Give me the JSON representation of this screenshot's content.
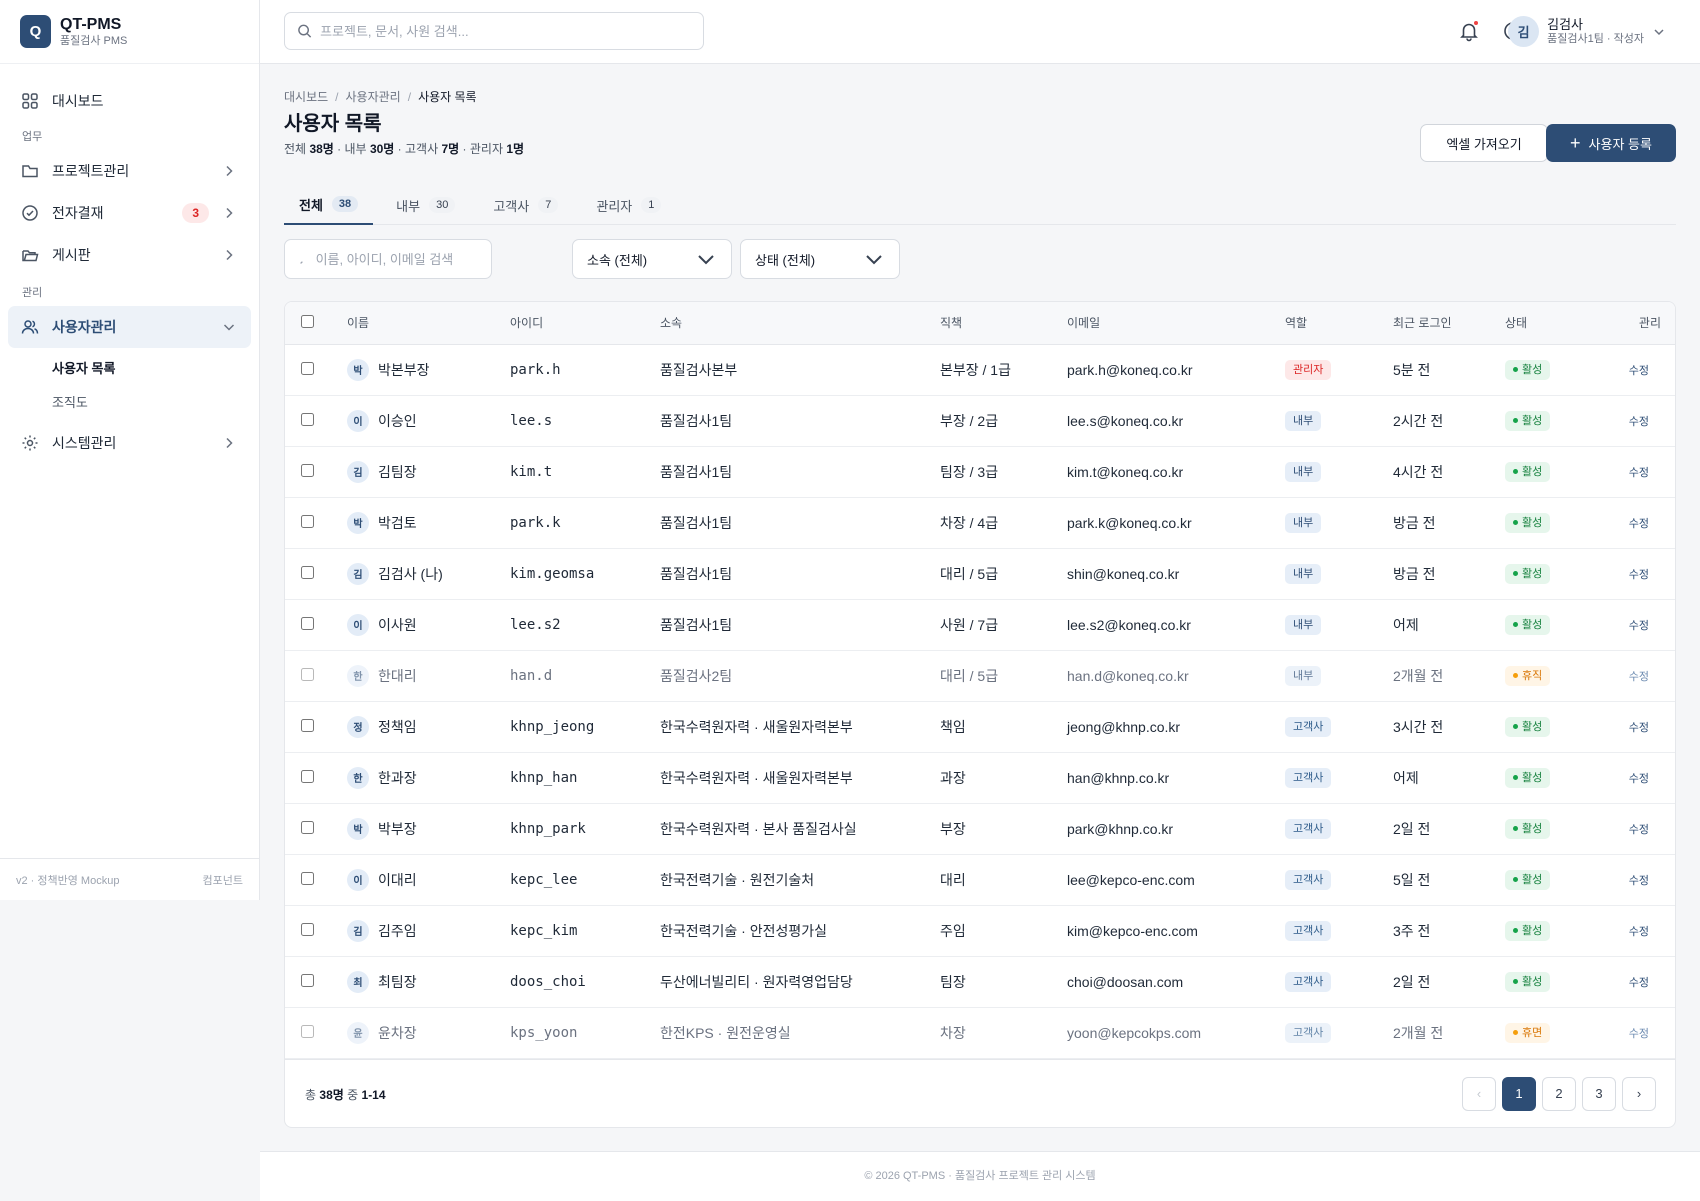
{
  "brand": {
    "logo": "Q",
    "title": "QT-PMS",
    "subtitle": "품질검사 PMS"
  },
  "sidebar": {
    "dashboard": "대시보드",
    "section_work": "업무",
    "projects": "프로젝트관리",
    "approval": "전자결재",
    "approval_badge": "3",
    "board": "게시판",
    "section_admin": "관리",
    "users": "사용자관리",
    "sub_user_list": "사용자 목록",
    "sub_org": "조직도",
    "system": "시스템관리",
    "footer_left": "v2 · 정책반영 Mockup",
    "footer_right": "컴포넌트"
  },
  "topbar": {
    "search_placeholder": "프로젝트, 문서, 사원 검색...",
    "user_initial": "김",
    "user_name": "김검사",
    "user_role": "품질검사1팀 · 작성자"
  },
  "breadcrumb": {
    "a": "대시보드",
    "b": "사용자관리",
    "current": "사용자 목록"
  },
  "page": {
    "title": "사용자 목록",
    "sub_total_label": "전체",
    "sub_total": "38명",
    "sub_internal_label": "· 내부",
    "sub_internal": "30명",
    "sub_client_label": "· 고객사",
    "sub_client": "7명",
    "sub_admin_label": "· 관리자",
    "sub_admin": "1명",
    "btn_excel": "엑셀 가져오기",
    "btn_add": "사용자 등록"
  },
  "tabs": [
    {
      "label": "전체",
      "count": "38"
    },
    {
      "label": "내부",
      "count": "30"
    },
    {
      "label": "고객사",
      "count": "7"
    },
    {
      "label": "관리자",
      "count": "1"
    }
  ],
  "filters": {
    "search_placeholder": "이름, 아이디, 이메일 검색",
    "org": "소속 (전체)",
    "status": "상태 (전체)"
  },
  "table": {
    "headers": [
      "이름",
      "아이디",
      "소속",
      "직책",
      "이메일",
      "역할",
      "최근 로그인",
      "상태",
      "관리"
    ],
    "edit_label": "수정",
    "rows": [
      {
        "initial": "박",
        "name": "박본부장",
        "id": "park.h",
        "org": "품질검사본부",
        "position": "본부장 / 1급",
        "email": "park.h@koneq.co.kr",
        "role": "관리자",
        "role_type": "admin",
        "login": "5분 전",
        "status": "활성",
        "status_type": "active",
        "dim": false
      },
      {
        "initial": "이",
        "name": "이승인",
        "id": "lee.s",
        "org": "품질검사1팀",
        "position": "부장 / 2급",
        "email": "lee.s@koneq.co.kr",
        "role": "내부",
        "role_type": "internal",
        "login": "2시간 전",
        "status": "활성",
        "status_type": "active",
        "dim": false
      },
      {
        "initial": "김",
        "name": "김팀장",
        "id": "kim.t",
        "org": "품질검사1팀",
        "position": "팀장 / 3급",
        "email": "kim.t@koneq.co.kr",
        "role": "내부",
        "role_type": "internal",
        "login": "4시간 전",
        "status": "활성",
        "status_type": "active",
        "dim": false
      },
      {
        "initial": "박",
        "name": "박검토",
        "id": "park.k",
        "org": "품질검사1팀",
        "position": "차장 / 4급",
        "email": "park.k@koneq.co.kr",
        "role": "내부",
        "role_type": "internal",
        "login": "방금 전",
        "status": "활성",
        "status_type": "active",
        "dim": false
      },
      {
        "initial": "김",
        "name": "김검사 (나)",
        "id": "kim.geomsa",
        "org": "품질검사1팀",
        "position": "대리 / 5급",
        "email": "shin@koneq.co.kr",
        "role": "내부",
        "role_type": "internal",
        "login": "방금 전",
        "status": "활성",
        "status_type": "active",
        "dim": false
      },
      {
        "initial": "이",
        "name": "이사원",
        "id": "lee.s2",
        "org": "품질검사1팀",
        "position": "사원 / 7급",
        "email": "lee.s2@koneq.co.kr",
        "role": "내부",
        "role_type": "internal",
        "login": "어제",
        "status": "활성",
        "status_type": "active",
        "dim": false
      },
      {
        "initial": "한",
        "name": "한대리",
        "id": "han.d",
        "org": "품질검사2팀",
        "position": "대리 / 5급",
        "email": "han.d@koneq.co.kr",
        "role": "내부",
        "role_type": "internal",
        "login": "2개월 전",
        "status": "휴직",
        "status_type": "inactive",
        "dim": true
      },
      {
        "initial": "정",
        "name": "정책임",
        "id": "khnp_jeong",
        "org": "한국수력원자력 · 새울원자력본부",
        "position": "책임",
        "email": "jeong@khnp.co.kr",
        "role": "고객사",
        "role_type": "client",
        "login": "3시간 전",
        "status": "활성",
        "status_type": "active",
        "dim": false
      },
      {
        "initial": "한",
        "name": "한과장",
        "id": "khnp_han",
        "org": "한국수력원자력 · 새울원자력본부",
        "position": "과장",
        "email": "han@khnp.co.kr",
        "role": "고객사",
        "role_type": "client",
        "login": "어제",
        "status": "활성",
        "status_type": "active",
        "dim": false
      },
      {
        "initial": "박",
        "name": "박부장",
        "id": "khnp_park",
        "org": "한국수력원자력 · 본사 품질검사실",
        "position": "부장",
        "email": "park@khnp.co.kr",
        "role": "고객사",
        "role_type": "client",
        "login": "2일 전",
        "status": "활성",
        "status_type": "active",
        "dim": false
      },
      {
        "initial": "이",
        "name": "이대리",
        "id": "kepc_lee",
        "org": "한국전력기술 · 원전기술처",
        "position": "대리",
        "email": "lee@kepco-enc.com",
        "role": "고객사",
        "role_type": "client",
        "login": "5일 전",
        "status": "활성",
        "status_type": "active",
        "dim": false
      },
      {
        "initial": "김",
        "name": "김주임",
        "id": "kepc_kim",
        "org": "한국전력기술 · 안전성평가실",
        "position": "주임",
        "email": "kim@kepco-enc.com",
        "role": "고객사",
        "role_type": "client",
        "login": "3주 전",
        "status": "활성",
        "status_type": "active",
        "dim": false
      },
      {
        "initial": "최",
        "name": "최팀장",
        "id": "doos_choi",
        "org": "두산에너빌리티 · 원자력영업담당",
        "position": "팀장",
        "email": "choi@doosan.com",
        "role": "고객사",
        "role_type": "client",
        "login": "2일 전",
        "status": "활성",
        "status_type": "active",
        "dim": false
      },
      {
        "initial": "윤",
        "name": "윤차장",
        "id": "kps_yoon",
        "org": "한전KPS · 원전운영실",
        "position": "차장",
        "email": "yoon@kepcokps.com",
        "role": "고객사",
        "role_type": "client",
        "login": "2개월 전",
        "status": "휴면",
        "status_type": "inactive",
        "dim": true
      }
    ]
  },
  "pagination": {
    "total_prefix": "총",
    "total": "38명",
    "range_prefix": "중",
    "range": "1-14",
    "prev": "‹",
    "next": "›",
    "pages": [
      "1",
      "2",
      "3"
    ],
    "current": "1"
  },
  "footer": {
    "text": "© 2026 QT-PMS · 품질검사 프로젝트 관리 시스템"
  },
  "colors": {
    "primary": "#2d4d75",
    "admin_red": "#dc2626",
    "active_green": "#15803d",
    "inactive_orange": "#d97706"
  }
}
